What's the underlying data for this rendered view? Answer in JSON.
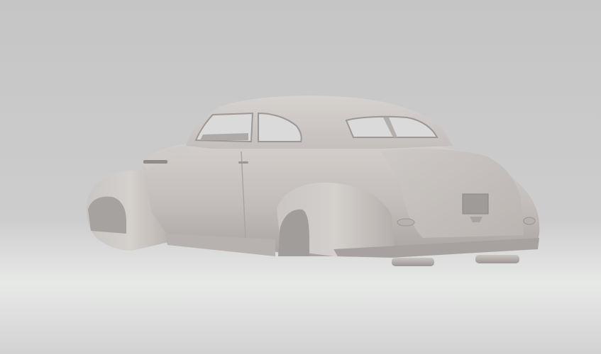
{
  "scene": {
    "subject": "car-body-3d-model",
    "colors": {
      "backdrop_top": "#c6c6c6",
      "backdrop_mid": "#cbcbcb",
      "floor_glow": "#e6e8e6",
      "floor_bottom": "#d2d2d2",
      "body_light": "#cfcbc8",
      "body_mid": "#bdb8b5",
      "body_dark": "#9f9a97",
      "window_glass": "#d9d9d9",
      "interior": "#a9a6a4"
    }
  }
}
